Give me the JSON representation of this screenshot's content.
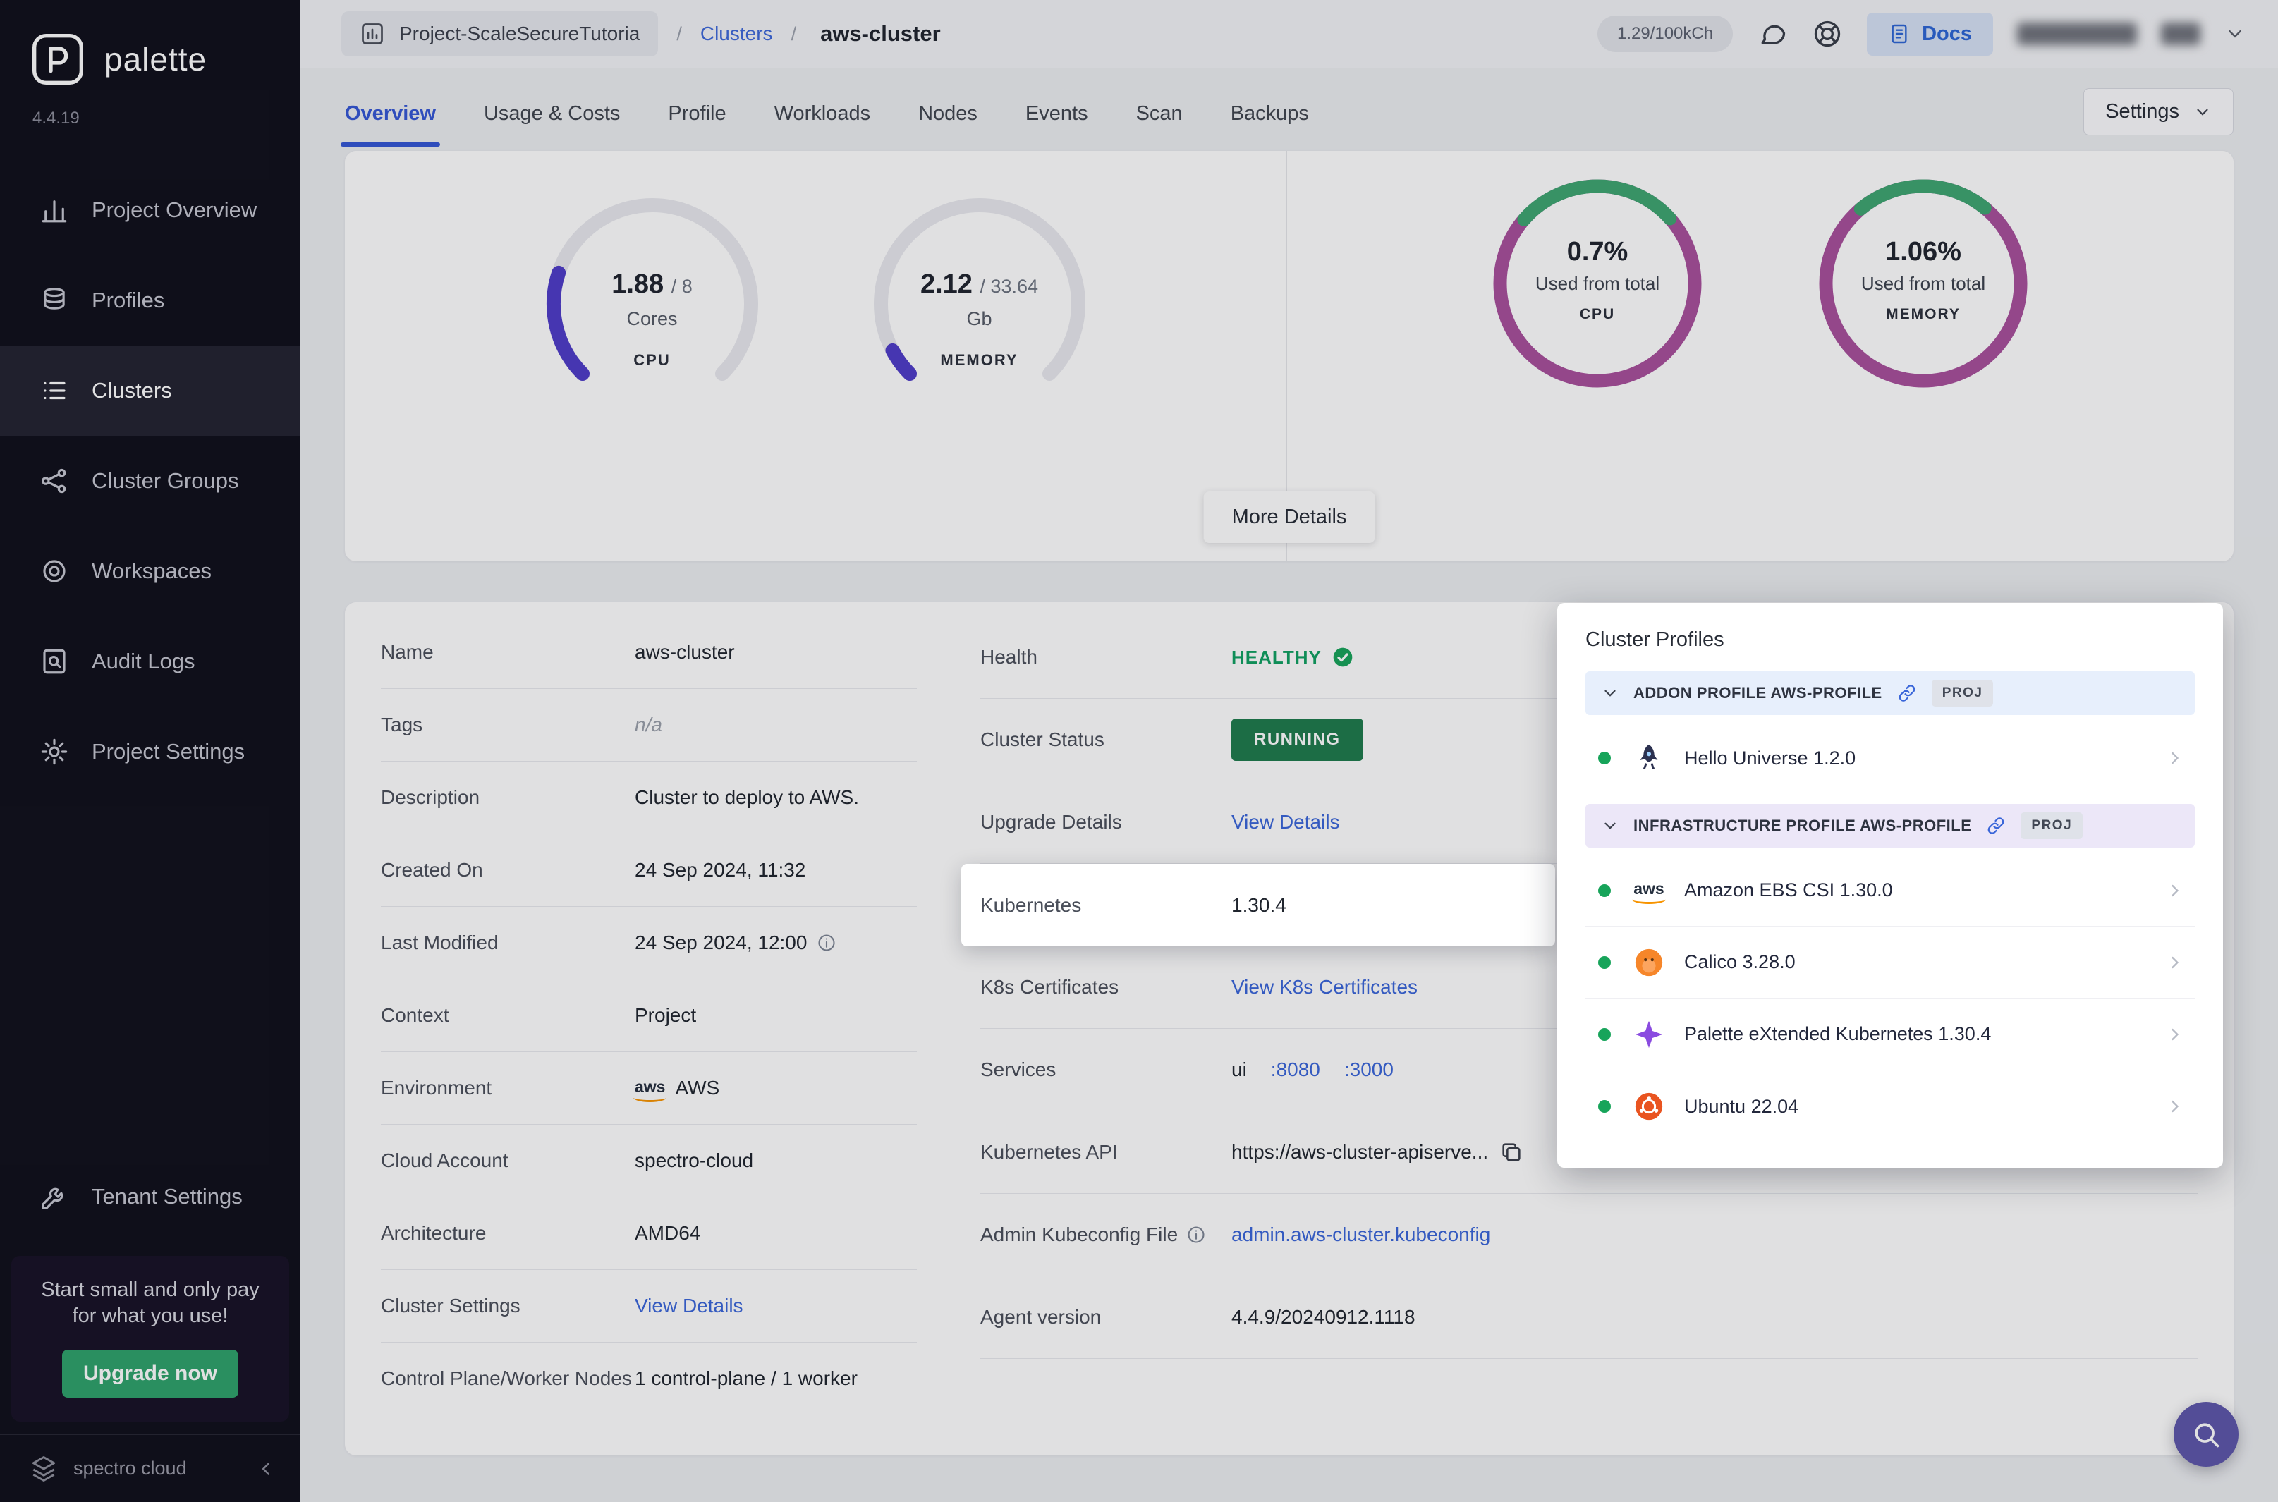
{
  "sidebar": {
    "brand": "palette",
    "version": "4.4.19",
    "items": [
      {
        "label": "Project Overview"
      },
      {
        "label": "Profiles"
      },
      {
        "label": "Clusters"
      },
      {
        "label": "Cluster Groups"
      },
      {
        "label": "Workspaces"
      },
      {
        "label": "Audit Logs"
      },
      {
        "label": "Project Settings"
      }
    ],
    "tenant_settings": "Tenant Settings",
    "promo": "Start small and only pay for what you use!",
    "upgrade": "Upgrade now",
    "footer_brand": "spectro cloud"
  },
  "header": {
    "project": "Project-ScaleSecureTutoria",
    "sep": "/",
    "clusters_crumb": "Clusters",
    "current_crumb": "aws-cluster",
    "usage": "1.29/100kCh",
    "docs": "Docs"
  },
  "tabs": {
    "items": [
      "Overview",
      "Usage & Costs",
      "Profile",
      "Workloads",
      "Nodes",
      "Events",
      "Scan",
      "Backups"
    ],
    "settings": "Settings"
  },
  "overview": {
    "cpu_gauge": {
      "value": "1.88",
      "den": "/ 8",
      "unit": "Cores",
      "label": "CPU"
    },
    "memory_gauge": {
      "value": "2.12",
      "den": "/ 33.64",
      "unit": "Gb",
      "label": "MEMORY"
    },
    "cpu_ring": {
      "percent": "0.7%",
      "caption": "Used from total",
      "label": "CPU"
    },
    "memory_ring": {
      "percent": "1.06%",
      "caption": "Used from total",
      "label": "MEMORY"
    },
    "more_details": "More Details"
  },
  "details_left": [
    {
      "label": "Name",
      "value": "aws-cluster"
    },
    {
      "label": "Tags",
      "value": "n/a"
    },
    {
      "label": "Description",
      "value": "Cluster to deploy to AWS."
    },
    {
      "label": "Created On",
      "value": "24 Sep 2024, 11:32"
    },
    {
      "label": "Last Modified",
      "value": "24 Sep 2024, 12:00"
    },
    {
      "label": "Context",
      "value": "Project"
    },
    {
      "label": "Environment",
      "value": "AWS"
    },
    {
      "label": "Cloud Account",
      "value": "spectro-cloud"
    },
    {
      "label": "Architecture",
      "value": "AMD64"
    },
    {
      "label": "Cluster Settings",
      "value": "View Details"
    },
    {
      "label": "Control Plane/Worker Nodes",
      "value": "1 control-plane / 1 worker"
    }
  ],
  "details_right": {
    "health_label": "Health",
    "health_value": "HEALTHY",
    "status_label": "Cluster Status",
    "status_value": "RUNNING",
    "upgrade_label": "Upgrade Details",
    "upgrade_value": "View Details",
    "kubernetes_label": "Kubernetes",
    "kubernetes_value": "1.30.4",
    "certs_label": "K8s Certificates",
    "certs_value": "View K8s Certificates",
    "services_label": "Services",
    "services_prefix": "ui",
    "services_ports": [
      ":8080",
      ":3000"
    ],
    "api_label": "Kubernetes API",
    "api_value": "https://aws-cluster-apiserve...",
    "kubeconfig_label": "Admin Kubeconfig File",
    "kubeconfig_value": "admin.aws-cluster.kubeconfig",
    "agent_label": "Agent version",
    "agent_value": "4.4.9/20240912.1118"
  },
  "cluster_profiles": {
    "title": "Cluster Profiles",
    "sections": [
      {
        "header": "ADDON PROFILE AWS-PROFILE",
        "badge": "PROJ",
        "items": [
          {
            "name": "Hello Universe 1.2.0"
          }
        ]
      },
      {
        "header": "INFRASTRUCTURE PROFILE AWS-PROFILE",
        "badge": "PROJ",
        "items": [
          {
            "name": "Amazon EBS CSI 1.30.0"
          },
          {
            "name": "Calico 3.28.0"
          },
          {
            "name": "Palette eXtended Kubernetes 1.30.4"
          },
          {
            "name": "Ubuntu 22.04"
          }
        ]
      }
    ]
  }
}
